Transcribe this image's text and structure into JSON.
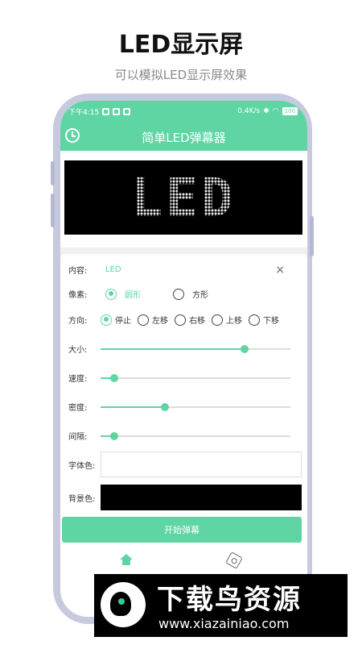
{
  "headline": "LED显示屏",
  "subheadline": "可以模拟LED显示屏效果",
  "status_bar": {
    "time": "下午4:15",
    "network_speed": "0.4K/s",
    "battery": "100"
  },
  "app": {
    "title": "简单LED弹幕器",
    "history_icon": "clock-icon"
  },
  "led_preview": {
    "text": "LED",
    "background_color": "#000000",
    "text_color": "#ffffff"
  },
  "form": {
    "content_label": "内容:",
    "content_value": "LED",
    "clear_icon": "×",
    "pixel_label": "像素:",
    "pixel_options": [
      "圆形",
      "方形"
    ],
    "pixel_selected": "圆形",
    "direction_label": "方向:",
    "direction_options": [
      "停止",
      "左移",
      "右移",
      "上移",
      "下移"
    ],
    "direction_selected": "停止",
    "size_label": "大小:",
    "size_value_percent": 76,
    "speed_label": "速度:",
    "speed_value_percent": 7,
    "density_label": "密度:",
    "density_value_percent": 34,
    "spacing_label": "间隔:",
    "spacing_value_percent": 7,
    "font_color_label": "字体色:",
    "font_color": "#ffffff",
    "bg_color_label": "背景色:",
    "bg_color": "#000000",
    "start_button": "开始弹幕"
  },
  "nav": {
    "home_icon": "home-icon",
    "settings_icon": "gear-icon"
  },
  "watermark": {
    "title": "下载鸟资源",
    "url": "www.xiazainiao.com"
  },
  "colors": {
    "accent": "#5fd5a4"
  }
}
